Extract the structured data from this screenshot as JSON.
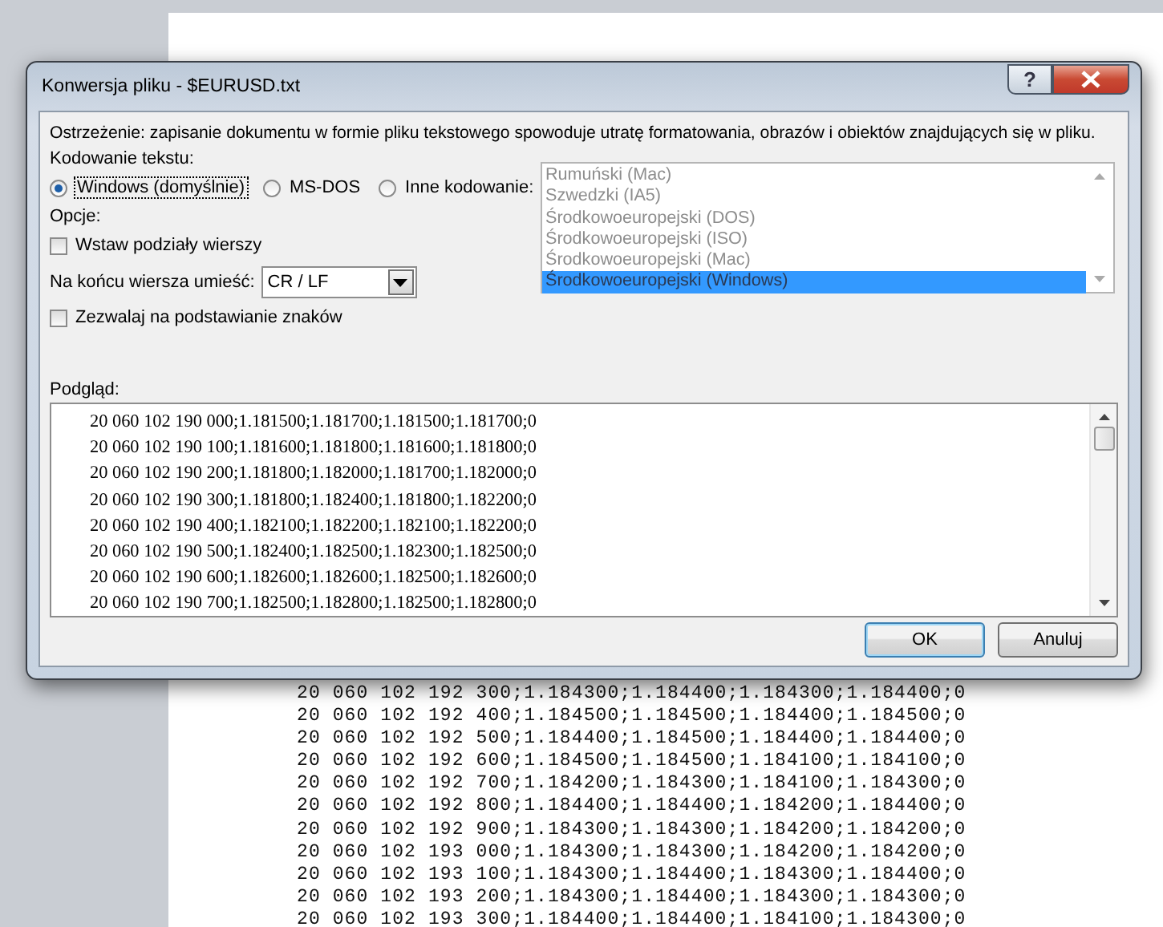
{
  "window": {
    "title": "Konwersja pliku - $EURUSD.txt",
    "help_button": "?"
  },
  "warning": "Ostrzeżenie: zapisanie dokumentu w formie pliku tekstowego spowoduje utratę formatowania, obrazów i obiektów znajdujących się w pliku.",
  "encoding_label": "Kodowanie tekstu:",
  "encoding_options": [
    {
      "label": "Windows (domyślnie)",
      "selected": true,
      "focused": true
    },
    {
      "label": "MS-DOS",
      "selected": false,
      "focused": false
    },
    {
      "label": "Inne kodowanie:",
      "selected": false,
      "focused": false
    }
  ],
  "encoding_list": {
    "disabled": true,
    "items": [
      {
        "label": "Rumuński (Mac)",
        "selected": false
      },
      {
        "label": "Szwedzki (IA5)",
        "selected": false
      },
      {
        "label": "Środkowoeuropejski (DOS)",
        "selected": false
      },
      {
        "label": "Środkowoeuropejski (ISO)",
        "selected": false
      },
      {
        "label": "Środkowoeuropejski (Mac)",
        "selected": false
      },
      {
        "label": "Środkowoeuropejski (Windows)",
        "selected": true
      }
    ]
  },
  "options_label": "Opcje:",
  "insert_line_breaks": {
    "label": "Wstaw podziały wierszy",
    "checked": false
  },
  "line_end": {
    "label": "Na końcu wiersza umieść:",
    "value": "CR / LF"
  },
  "allow_substitution": {
    "label": "Zezwalaj na podstawianie znaków",
    "checked": false
  },
  "preview_label": "Podgląd:",
  "preview_lines": [
    "20 060 102 190 000;1.181500;1.181700;1.181500;1.181700;0",
    "20 060 102 190 100;1.181600;1.181800;1.181600;1.181800;0",
    "20 060 102 190 200;1.181800;1.182000;1.181700;1.182000;0",
    "20 060 102 190 300;1.181800;1.182400;1.181800;1.182200;0",
    "20 060 102 190 400;1.182100;1.182200;1.182100;1.182200;0",
    "20 060 102 190 500;1.182400;1.182500;1.182300;1.182500;0",
    "20 060 102 190 600;1.182600;1.182600;1.182500;1.182600;0",
    "20 060 102 190 700;1.182500;1.182800;1.182500;1.182800;0"
  ],
  "buttons": [
    {
      "label": "OK",
      "default": true
    },
    {
      "label": "Anuluj",
      "default": false
    }
  ],
  "document_lines": [
    "20 060 102 192 300;1.184300;1.184400;1.184300;1.184400;0",
    "20 060 102 192 400;1.184500;1.184500;1.184400;1.184500;0",
    "20 060 102 192 500;1.184400;1.184500;1.184400;1.184400;0",
    "20 060 102 192 600;1.184500;1.184500;1.184100;1.184100;0",
    "20 060 102 192 700;1.184200;1.184300;1.184100;1.184300;0",
    "20 060 102 192 800;1.184400;1.184400;1.184200;1.184400;0",
    "20 060 102 192 900;1.184300;1.184300;1.184200;1.184200;0",
    "20 060 102 193 000;1.184300;1.184300;1.184200;1.184200;0",
    "20 060 102 193 100;1.184300;1.184400;1.184300;1.184400;0",
    "20 060 102 193 200;1.184300;1.184400;1.184300;1.184300;0",
    "20 060 102 193 300;1.184400;1.184400;1.184100;1.184300;0"
  ]
}
